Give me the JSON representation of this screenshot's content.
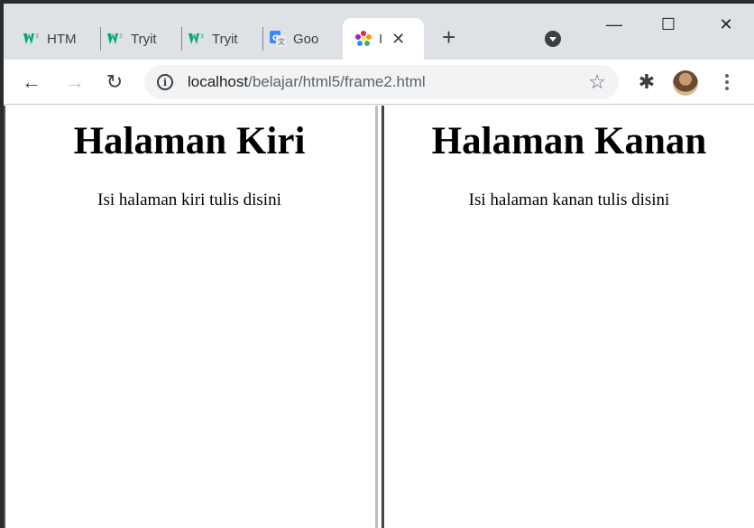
{
  "tabs": [
    {
      "title": "HTM",
      "icon": "w3schools-icon"
    },
    {
      "title": "Tryit",
      "icon": "w3schools-icon"
    },
    {
      "title": "Tryit",
      "icon": "w3schools-icon"
    },
    {
      "title": "Goo",
      "icon": "google-translate-icon"
    },
    {
      "title": "I",
      "icon": "colorful-flower-icon",
      "active": true
    }
  ],
  "new_tab_label": "+",
  "window_controls": {
    "minimize": "—",
    "maximize": "☐",
    "close": "✕"
  },
  "toolbar": {
    "back": "←",
    "forward": "→",
    "reload": "↻",
    "url_host": "localhost",
    "url_path": "/belajar/html5/frame2.html",
    "star": "☆",
    "extensions": "✱"
  },
  "frames": {
    "left": {
      "heading": "Halaman Kiri",
      "text": "Isi halaman kiri tulis disini"
    },
    "right": {
      "heading": "Halaman Kanan",
      "text": "Isi halaman kanan tulis disini"
    }
  },
  "colors": {
    "tabstrip": "#dee1e6",
    "w3_green": "#04aa6d",
    "omnibox": "#f1f3f4"
  }
}
